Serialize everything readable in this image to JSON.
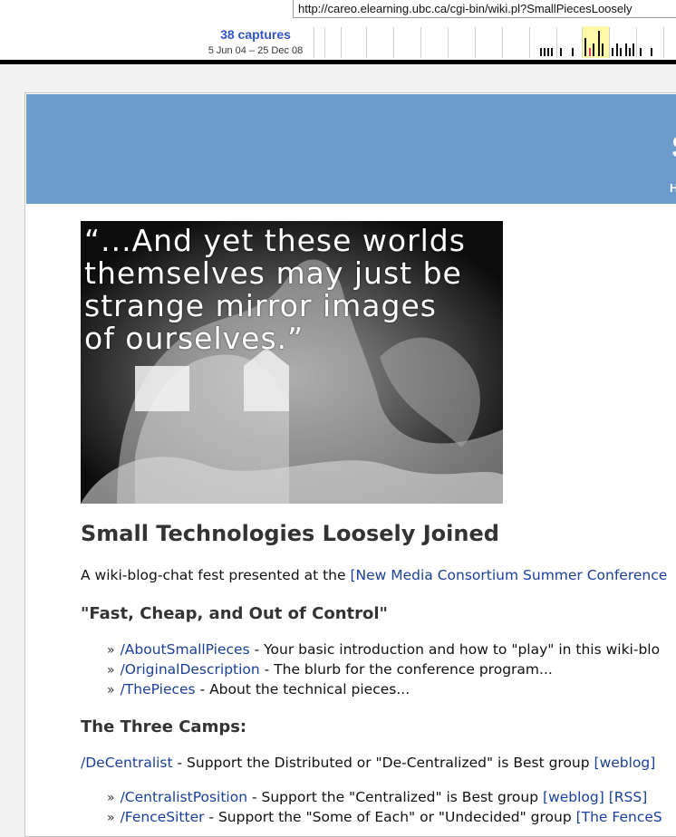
{
  "wayback": {
    "url": "http://careo.elearning.ubc.ca/cgi-bin/wiki.pl?SmallPiecesLoosely",
    "captures_label": "38 captures",
    "date_range": "5 Jun 04 – 25 Dec 08"
  },
  "quote_image": {
    "lines": [
      "“...And yet these worlds",
      "themselves may just be",
      "strange mirror images",
      "of ourselves.”"
    ]
  },
  "page": {
    "title": "Small Technologies Loosely Joined",
    "intro_text": "A wiki-blog-chat fest presented at the ",
    "intro_link": "[New Media Consortium Summer Conference",
    "section1_title": "\"Fast, Cheap, and Out of Control\"",
    "list1": [
      {
        "link": "/AboutSmallPieces",
        "text": " - Your basic introduction and how to \"play\" in this wiki-blo"
      },
      {
        "link": "/OriginalDescription",
        "text": " - The blurb for the conference program..."
      },
      {
        "link": "/ThePieces",
        "text": " - About the technical pieces..."
      }
    ],
    "section2_title": "The Three Camps:",
    "decentralist": {
      "link": "/DeCentralist",
      "text": " - Support the Distributed or \"De-Centralized\" is Best group ",
      "weblog": "[weblog]"
    },
    "list2": [
      {
        "link": "/CentralistPosition",
        "text": " - Support the \"Centralized\" is Best group ",
        "weblog": "[weblog]",
        "rss": "[RSS]"
      },
      {
        "link": "/FenceSitter",
        "text": " - Support the \"Some of Each\" or \"Undecided\" group ",
        "extra": "[The FenceS"
      }
    ]
  },
  "colors": {
    "header_band": "#6a9ccc",
    "link": "#1a3f9a",
    "captures": "#3355cc"
  }
}
